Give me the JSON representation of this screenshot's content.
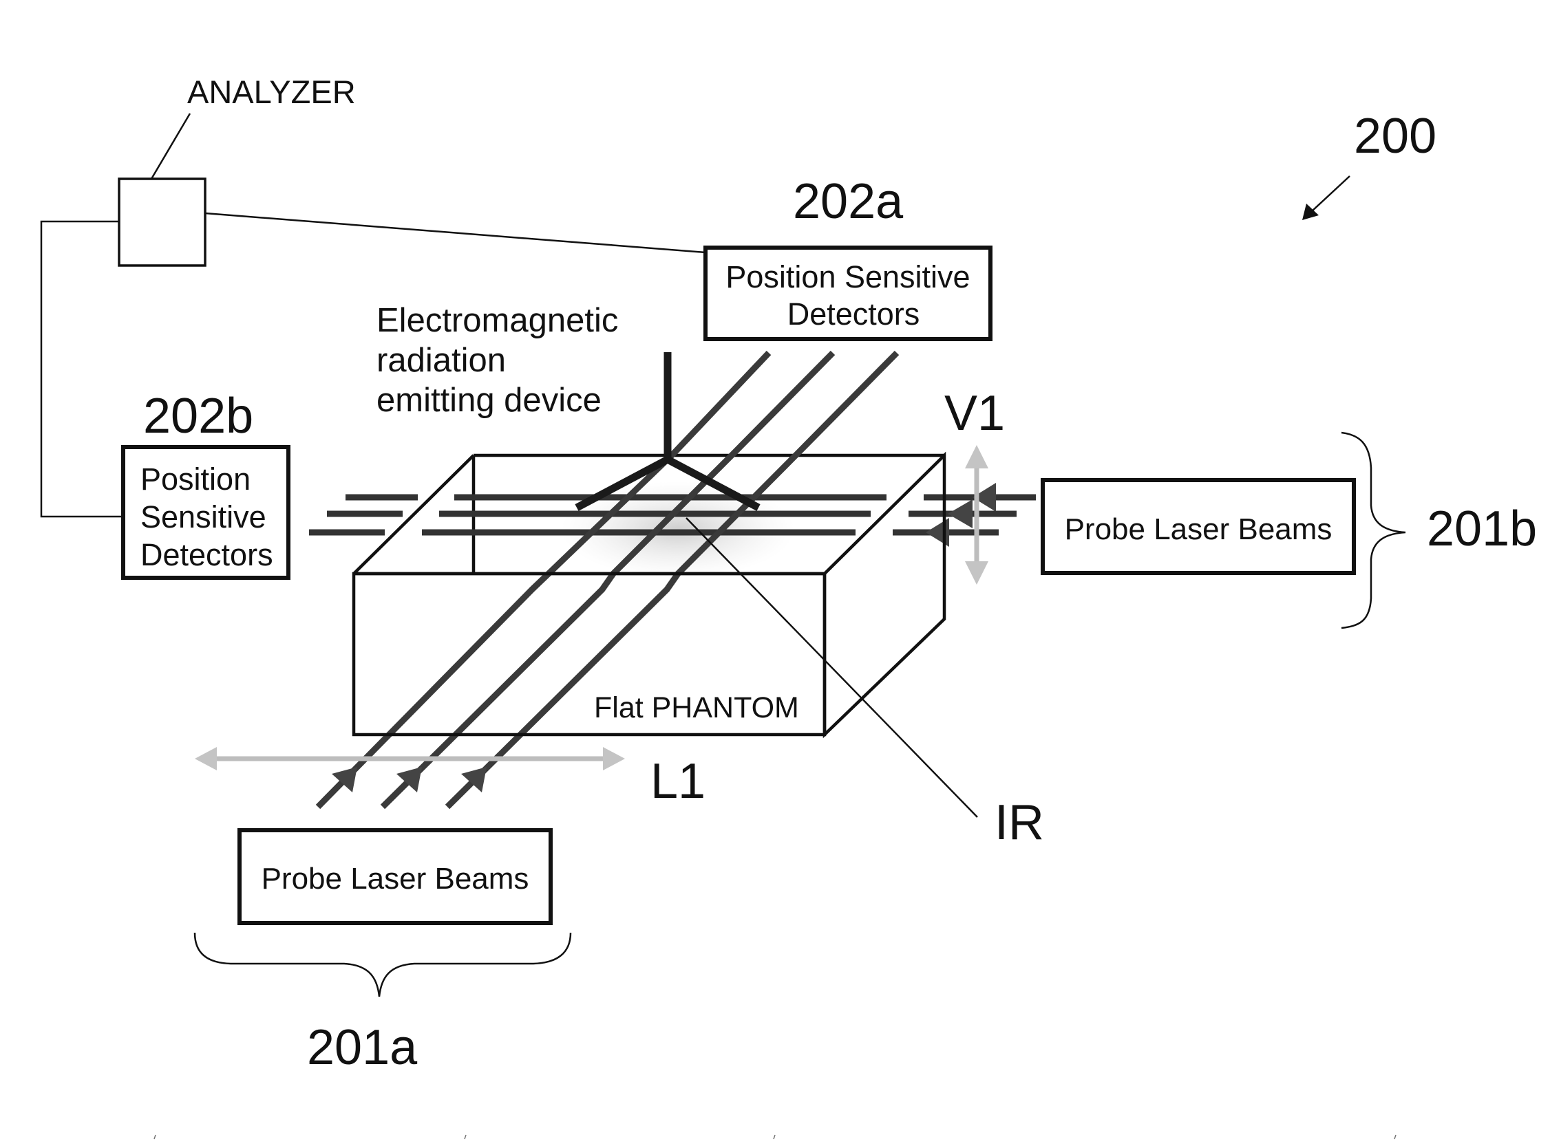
{
  "figure": {
    "reference_number": "200",
    "analyzer": {
      "label": "ANALYZER"
    },
    "detectors": [
      {
        "ref": "202a",
        "label_lines": [
          "Position Sensitive",
          "Detectors"
        ]
      },
      {
        "ref": "202b",
        "label_lines": [
          "Position",
          "Sensitive",
          "Detectors"
        ]
      }
    ],
    "probe_sources": [
      {
        "ref": "201a",
        "label": "Probe Laser Beams"
      },
      {
        "ref": "201b",
        "label": "Probe Laser Beams"
      }
    ],
    "emitter": {
      "label_lines": [
        "Electromagnetic",
        "radiation",
        "emitting device"
      ]
    },
    "phantom": {
      "label": "Flat PHANTOM"
    },
    "motion_labels": {
      "lateral": "L1",
      "vertical": "V1"
    },
    "region_label": "IR",
    "colors": {
      "line": "#111111",
      "beam": "#3a3a3a",
      "motion_arrow": "#bdbdbd",
      "irradiated_region": "#d9d9d9"
    }
  }
}
